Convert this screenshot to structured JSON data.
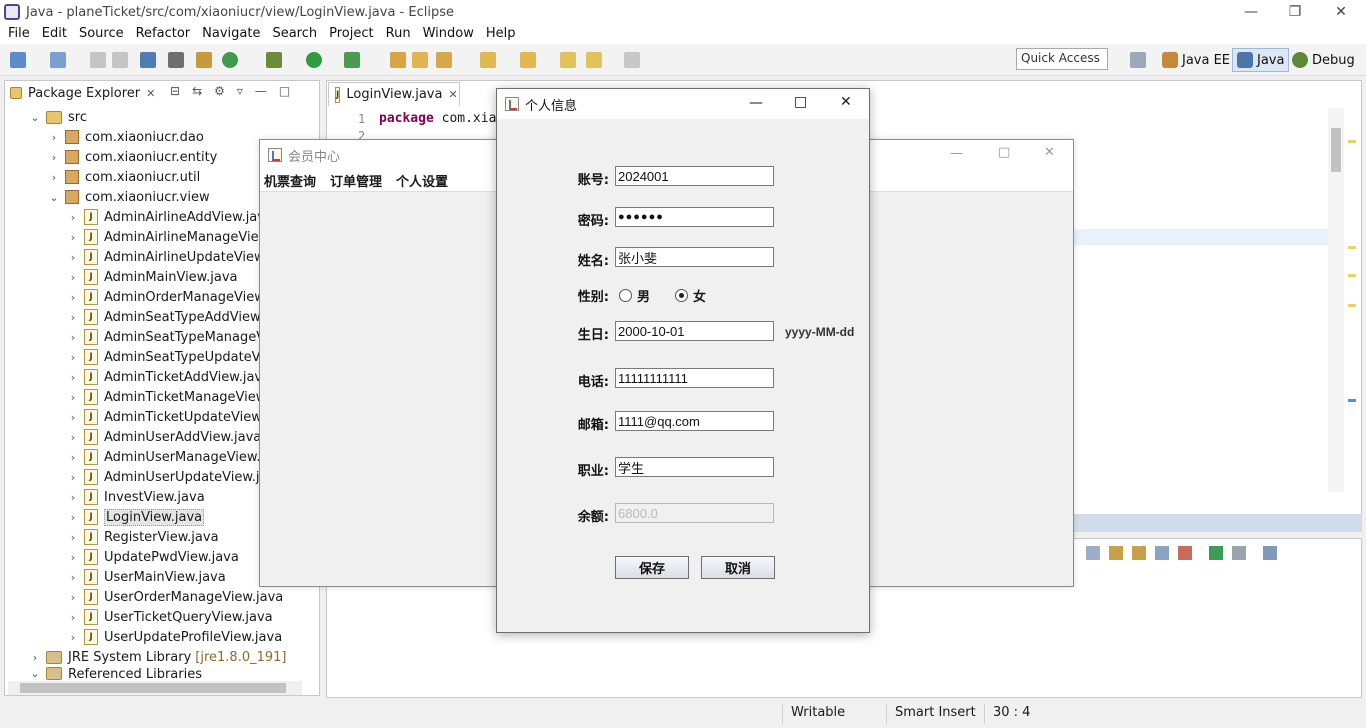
{
  "window": {
    "title": "Java - planeTicket/src/com/xiaoniucr/view/LoginView.java - Eclipse",
    "minimize": "—",
    "maximize": "❐",
    "close": "✕"
  },
  "menu": [
    "File",
    "Edit",
    "Source",
    "Refactor",
    "Navigate",
    "Search",
    "Project",
    "Run",
    "Window",
    "Help"
  ],
  "toolbar": {
    "quick_access": "Quick Access",
    "perspectives": [
      "Java EE",
      "Java",
      "Debug"
    ]
  },
  "package_explorer": {
    "tab_label": "Package Explorer",
    "src": "src",
    "packages": [
      "com.xiaoniucr.dao",
      "com.xiaoniucr.entity",
      "com.xiaoniucr.util",
      "com.xiaoniucr.view"
    ],
    "files": [
      "AdminAirlineAddView.java",
      "AdminAirlineManageView.j",
      "AdminAirlineUpdateView.ja",
      "AdminMainView.java",
      "AdminOrderManageView.j",
      "AdminSeatTypeAddView.ja",
      "AdminSeatTypeManageVie",
      "AdminSeatTypeUpdateView",
      "AdminTicketAddView.java",
      "AdminTicketManageView.j",
      "AdminTicketUpdateView.ja",
      "AdminUserAddView.java",
      "AdminUserManageView.ja",
      "AdminUserUpdateView.jav",
      "InvestView.java",
      "LoginView.java",
      "RegisterView.java",
      "UpdatePwdView.java",
      "UserMainView.java",
      "UserOrderManageView.java",
      "UserTicketQueryView.java",
      "UserUpdateProfileView.java"
    ],
    "jre": "JRE System Library",
    "jre_version": "[jre1.8.0_191]",
    "ref_libs": "Referenced Libraries"
  },
  "editor": {
    "tab_label": "LoginView.java",
    "line1_num": "1",
    "line2_num": "2",
    "line1_kw": "package",
    "line1_rest": " com.xia"
  },
  "status": {
    "writable": "Writable",
    "insert_mode": "Smart Insert",
    "position": "30 : 4"
  },
  "member_window": {
    "title": "会员中心",
    "menu": [
      "机票查询",
      "订单管理",
      "个人设置"
    ]
  },
  "dialog": {
    "title": "个人信息",
    "labels": {
      "account": "账号:",
      "password": "密码:",
      "name": "姓名:",
      "gender": "性别:",
      "birthday": "生日:",
      "phone": "电话:",
      "email": "邮箱:",
      "job": "职业:",
      "balance": "余额:"
    },
    "values": {
      "account": "2024001",
      "password": "●●●●●●",
      "name": "张小斐",
      "birthday": "2000-10-01",
      "phone": "11111111111",
      "email": "1111@qq.com",
      "job": "学生",
      "balance": "6800.0"
    },
    "gender_options": [
      "男",
      "女"
    ],
    "gender_selected": "女",
    "date_hint": "yyyy-MM-dd",
    "save": "保存",
    "cancel": "取消"
  }
}
